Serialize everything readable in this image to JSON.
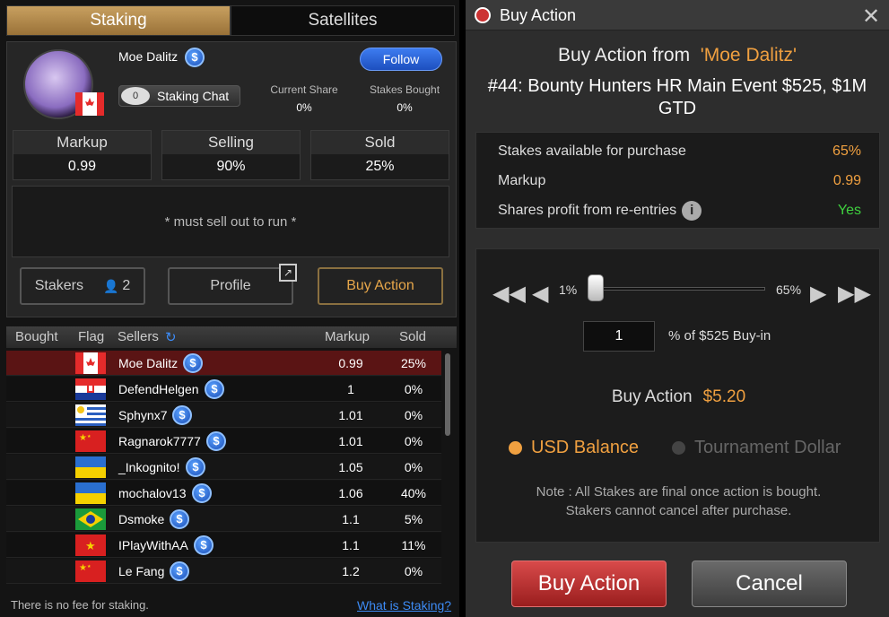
{
  "tabs": {
    "staking": "Staking",
    "satellites": "Satellites"
  },
  "player": {
    "name": "Moe Dalitz",
    "follow_label": "Follow",
    "chat_count": "0",
    "chat_label": "Staking Chat",
    "current_share_label": "Current Share",
    "current_share_value": "0%",
    "stakes_bought_label": "Stakes Bought",
    "stakes_bought_value": "0%"
  },
  "stats": {
    "markup_label": "Markup",
    "markup_value": "0.99",
    "selling_label": "Selling",
    "selling_value": "90%",
    "sold_label": "Sold",
    "sold_value": "25%"
  },
  "sell_note": "* must sell out to run *",
  "buttons": {
    "stakers": "Stakers",
    "stakers_count": "2",
    "profile": "Profile",
    "buy_action": "Buy Action"
  },
  "table": {
    "headers": {
      "bought": "Bought",
      "flag": "Flag",
      "sellers": "Sellers",
      "markup": "Markup",
      "sold": "Sold"
    },
    "rows": [
      {
        "seller": "Moe Dalitz",
        "markup": "0.99",
        "sold": "25%",
        "flag": "canada"
      },
      {
        "seller": "DefendHelgen",
        "markup": "1",
        "sold": "0%",
        "flag": "croatia"
      },
      {
        "seller": "Sphynx7",
        "markup": "1.01",
        "sold": "0%",
        "flag": "uruguay"
      },
      {
        "seller": "Ragnarok7777",
        "markup": "1.01",
        "sold": "0%",
        "flag": "china"
      },
      {
        "seller": "_Inkognito!",
        "markup": "1.05",
        "sold": "0%",
        "flag": "ukraine"
      },
      {
        "seller": "mochalov13",
        "markup": "1.06",
        "sold": "40%",
        "flag": "ukraine"
      },
      {
        "seller": "Dsmoke",
        "markup": "1.1",
        "sold": "5%",
        "flag": "brazil"
      },
      {
        "seller": "IPlayWithAA",
        "markup": "1.1",
        "sold": "11%",
        "flag": "vietnam"
      },
      {
        "seller": "Le Fang",
        "markup": "1.2",
        "sold": "0%",
        "flag": "china"
      }
    ]
  },
  "footer": {
    "no_fee": "There is no fee for staking.",
    "what_is": "What is Staking?"
  },
  "dialog": {
    "title": "Buy Action",
    "from_prefix": "Buy Action from",
    "from_name": "'Moe Dalitz'",
    "event": "#44: Bounty Hunters HR Main Event $525, $1M GTD",
    "info": {
      "available_label": "Stakes available for purchase",
      "available_value": "65%",
      "markup_label": "Markup",
      "markup_value": "0.99",
      "reentry_label": "Shares profit from re-entries",
      "reentry_value": "Yes"
    },
    "slider": {
      "min_label": "1%",
      "max_label": "65%",
      "value": 0.0
    },
    "percent_input": "1",
    "percent_label": "% of $525 Buy-in",
    "buy_action_label": "Buy Action",
    "buy_action_value": "$5.20",
    "balance_options": {
      "usd": "USD Balance",
      "td": "Tournament Dollar"
    },
    "note_line1": "Note : All Stakes are final once action is bought.",
    "note_line2": "Stakers cannot cancel after purchase.",
    "buy_button": "Buy Action",
    "cancel_button": "Cancel"
  },
  "colors": {
    "accent": "#f0a040",
    "link": "#3d8bf5",
    "yes": "#3fd13f",
    "buy_red": "#c33333"
  }
}
